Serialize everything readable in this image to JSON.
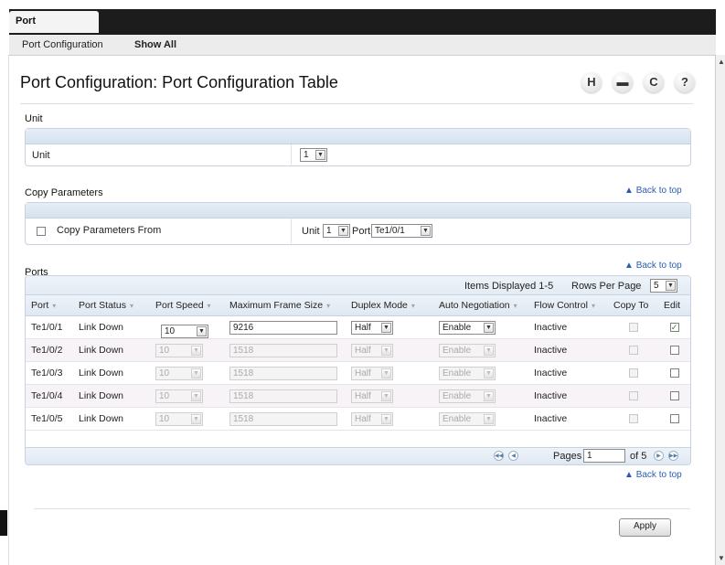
{
  "app": {
    "tab_title": "Port Configuration",
    "subnav": [
      "Port Configuration",
      "Show All"
    ]
  },
  "page": {
    "title": "Port Configuration: Port Configuration Table",
    "tools": {
      "save": "H",
      "print": "▬",
      "refresh": "C",
      "help": "?"
    }
  },
  "unit_section": {
    "title": "Unit",
    "label": "Unit",
    "value": "1"
  },
  "copy_section": {
    "title": "Copy Parameters",
    "back_to_top": "Back to top",
    "checkbox_label": "Copy Parameters From",
    "unit_label": "Unit",
    "unit_value": "1",
    "port_label": "Port",
    "port_value": "Te1/0/1"
  },
  "ports_section": {
    "title": "Ports",
    "back_to_top": "Back to top",
    "items_displayed": "Items Displayed 1-5",
    "rows_per_page_label": "Rows Per Page",
    "rows_per_page": "5",
    "columns": [
      "Port",
      "Port Status",
      "Port Speed",
      "Maximum Frame Size",
      "Duplex Mode",
      "Auto Negotiation",
      "Flow Control",
      "Copy To",
      "Edit"
    ],
    "rows": [
      {
        "port": "Te1/0/1",
        "status": "Link Down",
        "speed": "10",
        "frame": "9216",
        "duplex": "Half",
        "autoneg": "Enable",
        "flow": "Inactive"
      },
      {
        "port": "Te1/0/2",
        "status": "Link Down",
        "speed": "10",
        "frame": "1518",
        "duplex": "Half",
        "autoneg": "Enable",
        "flow": "Inactive"
      },
      {
        "port": "Te1/0/3",
        "status": "Link Down",
        "speed": "10",
        "frame": "1518",
        "duplex": "Half",
        "autoneg": "Enable",
        "flow": "Inactive"
      },
      {
        "port": "Te1/0/4",
        "status": "Link Down",
        "speed": "10",
        "frame": "1518",
        "duplex": "Half",
        "autoneg": "Enable",
        "flow": "Inactive"
      },
      {
        "port": "Te1/0/5",
        "status": "Link Down",
        "speed": "10",
        "frame": "1518",
        "duplex": "Half",
        "autoneg": "Enable",
        "flow": "Inactive"
      }
    ],
    "pages_label": "Pages",
    "page_value": "1",
    "of_label": "of 5",
    "bottom_back_to_top": "Back to top"
  },
  "apply_label": "Apply"
}
